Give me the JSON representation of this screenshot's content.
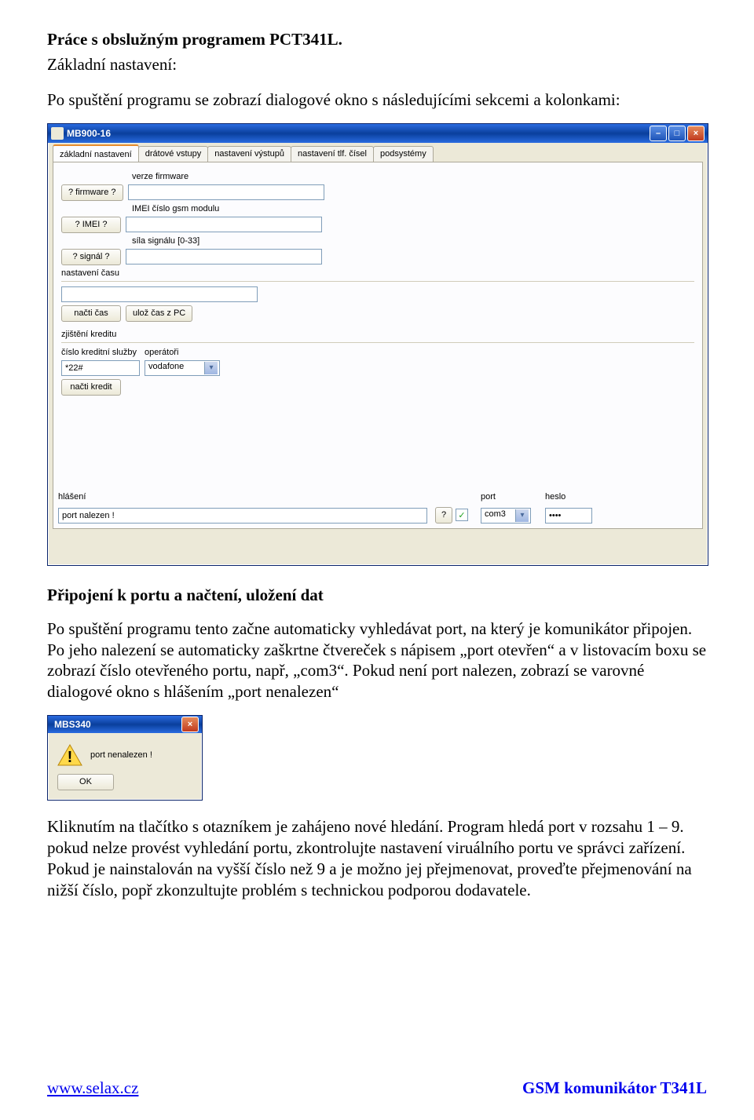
{
  "doc": {
    "h1": "Práce s obslužným programem PCT341L.",
    "intro_label": "Základní nastavení:",
    "intro_body": "Po spuštění programu se zobrazí dialogové okno s následujícími sekcemi a kolonkami:",
    "sec2_title": "Připojení k portu a načtení, uložení dat",
    "sec2_body": "Po spuštění programu tento začne automaticky vyhledávat port, na který je komunikátor připojen. Po jeho nalezení se automaticky zaškrtne čtvereček s nápisem „port otevřen“ a v listovacím boxu se zobrazí číslo otevřeného portu, např, „com3“. Pokud není port nalezen, zobrazí se varovné dialogové okno s hlášením „port nenalezen“",
    "sec3_body": "Kliknutím na tlačítko s otazníkem je zahájeno nové hledání. Program hledá port v rozsahu 1 – 9. pokud nelze provést vyhledání portu, zkontrolujte nastavení viruálního portu ve správci zařízení. Pokud je nainstalován na vyšší číslo než 9  a je možno jej přejmenovat, proveďte přejmenování na nižší číslo, popř zkonzultujte problém s technickou podporou dodavatele."
  },
  "footer": {
    "url": "www.selax.cz",
    "product": "GSM komunikátor T341L"
  },
  "app": {
    "window_title": "MB900-16",
    "tabs": [
      "základní nastavení",
      "drátové vstupy",
      "nastavení výstupů",
      "nastavení tlf. čísel",
      "podsystémy"
    ],
    "firmware_label": "verze firmware",
    "firmware_btn": "? firmware ?",
    "imei_label": "IMEI číslo gsm modulu",
    "imei_btn": "? IMEI ?",
    "signal_label": "síla signálu [0-33]",
    "signal_btn": "? signál ?",
    "time_label": "nastavení času",
    "time_btn1": "načti čas",
    "time_btn2": "ulož čas z PC",
    "kredit_label": "zjištění kreditu",
    "ksl_label": "číslo kreditní služby",
    "op_label": "operátoři",
    "ksl_value": "*22#",
    "op_value": "vodafone",
    "kredit_btn": "načti kredit",
    "hlaseni_label": "hlášení",
    "hlaseni_value": "port nalezen !",
    "qbtn": "?",
    "port_label": "port",
    "port_value": "com3",
    "heslo_label": "heslo",
    "heslo_value": "••••",
    "checkbox_mark": "✓"
  },
  "alert": {
    "title": "MBS340",
    "msg": "port nenalezen !",
    "ok": "OK",
    "closex": "×"
  }
}
